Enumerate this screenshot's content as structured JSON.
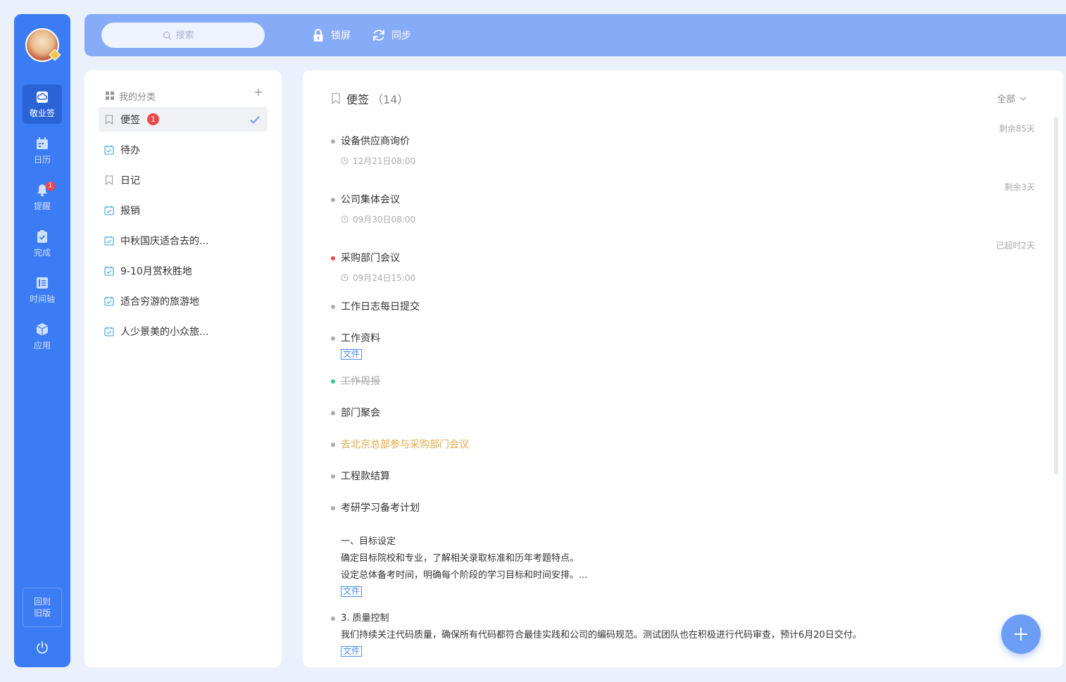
{
  "rail": {
    "items": [
      {
        "label": "敬业签",
        "icon": "note-cloud-icon"
      },
      {
        "label": "日历",
        "icon": "calendar-icon"
      },
      {
        "label": "提醒",
        "icon": "bell-icon",
        "badge": "1"
      },
      {
        "label": "完成",
        "icon": "clipboard-check-icon"
      },
      {
        "label": "时间轴",
        "icon": "timeline-icon"
      },
      {
        "label": "应用",
        "icon": "cube-icon"
      }
    ],
    "back_old_line1": "回到",
    "back_old_line2": "旧版"
  },
  "topbar": {
    "search_placeholder": "搜索",
    "lock_label": "锁屏",
    "sync_label": "同步"
  },
  "categories": {
    "header": "我的分类",
    "items": [
      {
        "label": "便签",
        "badge": "1",
        "icon": "bookmark-icon",
        "active": true
      },
      {
        "label": "待办",
        "icon": "todo-icon"
      },
      {
        "label": "日记",
        "icon": "bookmark-icon"
      },
      {
        "label": "报销",
        "icon": "todo-icon"
      },
      {
        "label": "中秋国庆适合去的...",
        "icon": "todo-icon"
      },
      {
        "label": "9-10月赏秋胜地",
        "icon": "todo-icon"
      },
      {
        "label": "适合穷游的旅游地",
        "icon": "todo-icon"
      },
      {
        "label": "人少景美的小众旅...",
        "icon": "todo-icon"
      }
    ]
  },
  "main": {
    "title": "便签",
    "count": "（14）",
    "filter_label": "全部",
    "tag_label": "文件",
    "notes": [
      {
        "title": "设备供应商询价",
        "time": "12月21日08:00",
        "remain": "剩余85天"
      },
      {
        "title": "公司集体会议",
        "time": "09月30日08:00",
        "remain": "剩余3天"
      },
      {
        "title": "采购部门会议",
        "time": "09月24日15:00",
        "remain": "已超时2天"
      },
      {
        "title": "工作日志每日提交"
      },
      {
        "title": "工作资料"
      },
      {
        "title": "工作周报"
      },
      {
        "title": "部门聚会"
      },
      {
        "title": "去北京总部参与采购部门会议"
      },
      {
        "title": "工程款结算"
      },
      {
        "title": "考研学习备考计划"
      },
      {
        "title": "3. 质量控制"
      }
    ],
    "study_plan_lines": [
      "一、目标设定",
      "确定目标院校和专业，了解相关录取标准和历年考题特点。",
      "设定总体备考时间，明确每个阶段的学习目标和时间安排。..."
    ],
    "quality_line": "我们持续关注代码质量，确保所有代码都符合最佳实践和公司的编码规范。测试团队也在积极进行代码审查，预计6月20日交付。"
  },
  "colors": {
    "rail_bg": "#3b7bf3",
    "topbar_bg": "#86abf7",
    "accent": "#4a8cf5",
    "badge_red": "#f0474a",
    "overdue_dot": "#f0474a",
    "done_dot": "#2ecc8a",
    "highlight_text": "#e0a84a"
  }
}
